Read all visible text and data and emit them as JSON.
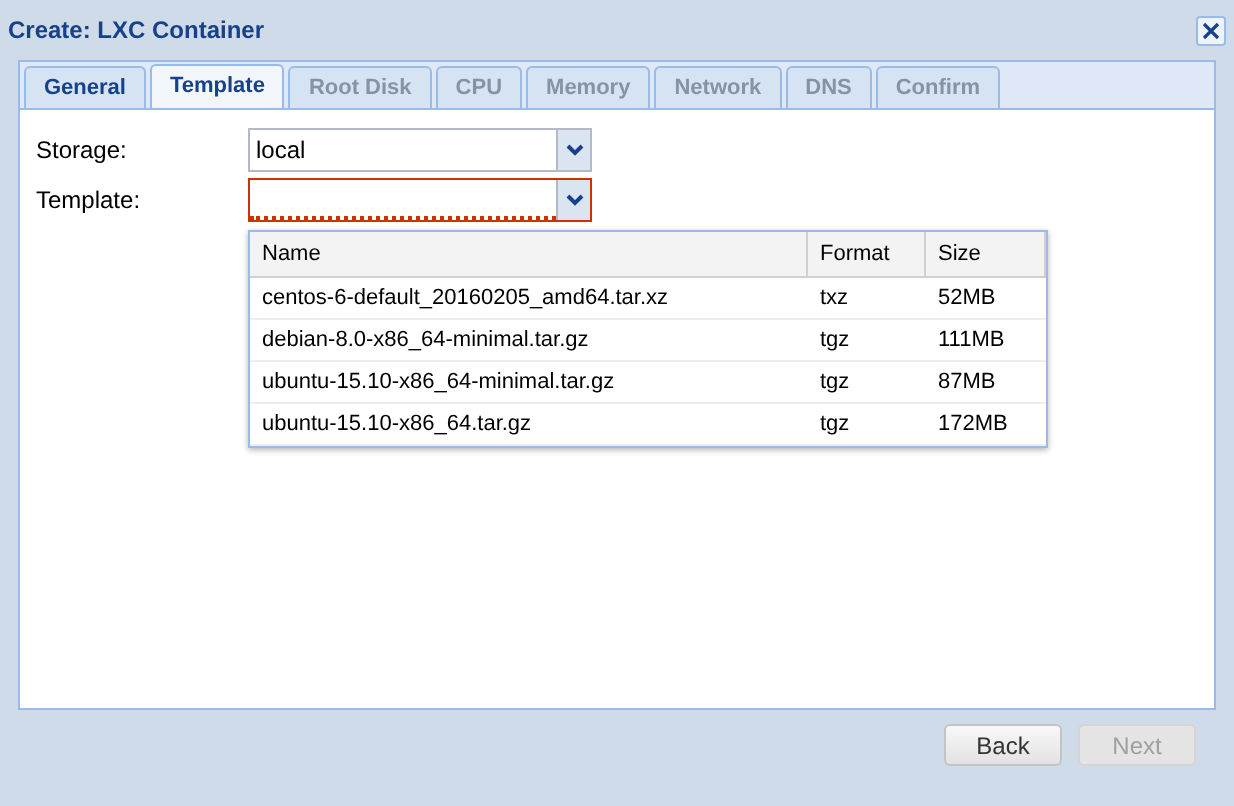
{
  "window": {
    "title": "Create: LXC Container"
  },
  "tabs": [
    {
      "label": "General",
      "selected": false,
      "disabled": false
    },
    {
      "label": "Template",
      "selected": true,
      "disabled": false
    },
    {
      "label": "Root Disk",
      "selected": false,
      "disabled": true
    },
    {
      "label": "CPU",
      "selected": false,
      "disabled": true
    },
    {
      "label": "Memory",
      "selected": false,
      "disabled": true
    },
    {
      "label": "Network",
      "selected": false,
      "disabled": true
    },
    {
      "label": "DNS",
      "selected": false,
      "disabled": true
    },
    {
      "label": "Confirm",
      "selected": false,
      "disabled": true
    }
  ],
  "fields": [
    {
      "label": "Storage:",
      "value": "local",
      "invalid": false
    },
    {
      "label": "Template:",
      "invalid": true
    }
  ],
  "dropdown": {
    "columns": [
      "Name",
      "Format",
      "Size"
    ],
    "rows": [
      [
        "centos-6-default_20160205_amd64.tar.xz",
        "txz",
        "52MB"
      ],
      [
        "debian-8.0-x86_64-minimal.tar.gz",
        "tgz",
        "111MB"
      ],
      [
        "ubuntu-15.10-x86_64-minimal.tar.gz",
        "tgz",
        "87MB"
      ],
      [
        "ubuntu-15.10-x86_64.tar.gz",
        "tgz",
        "172MB"
      ]
    ]
  },
  "buttons": [
    {
      "label": "Back",
      "disabled": false
    },
    {
      "label": "Next",
      "disabled": true
    }
  ]
}
